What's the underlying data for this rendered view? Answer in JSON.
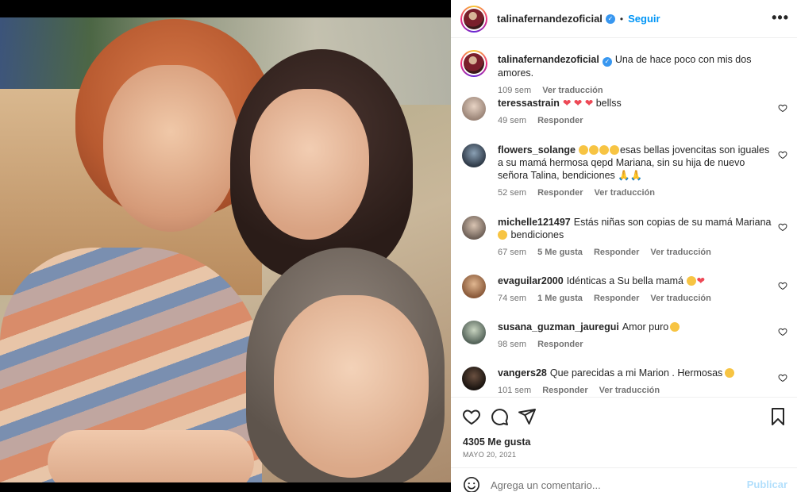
{
  "post": {
    "author": "talinafernandezoficial",
    "follow_label": "Seguir",
    "dot_separator": "•",
    "more_label": "•••",
    "caption": {
      "username": "talinafernandezoficial",
      "text": "Una de hace poco con mis dos amores.",
      "time": "109 sem",
      "translate": "Ver traducción"
    }
  },
  "comments": [
    {
      "username": "teressastrain",
      "text": "bellss",
      "emojis": [
        "red-heart",
        "red-heart",
        "red-heart"
      ],
      "time": "49 sem",
      "likes": "",
      "reply": "Responder",
      "translate": ""
    },
    {
      "username": "flowers_solange",
      "text": "esas bellas jovencitas son iguales a su mamá hermosa qepd Mariana, sin su hija de nuevo señora Talina, bendiciones",
      "emojis": [
        "surprised-face",
        "surprised-face",
        "surprised-face",
        "surprised-face"
      ],
      "trailing_emojis": [
        "praying-hands",
        "praying-hands"
      ],
      "time": "52 sem",
      "likes": "",
      "reply": "Responder",
      "translate": "Ver traducción"
    },
    {
      "username": "michelle121497",
      "text": "Estás niñas son copias de su mamá Mariana",
      "trailing_text": "bendiciones",
      "emojis": [
        "smiling-face"
      ],
      "time": "67 sem",
      "likes": "5 Me gusta",
      "reply": "Responder",
      "translate": "Ver traducción"
    },
    {
      "username": "evaguilar2000",
      "text": "Idénticas a Su bella mamá",
      "trailing_emojis": [
        "screaming-face",
        "red-heart"
      ],
      "time": "74 sem",
      "likes": "1 Me gusta",
      "reply": "Responder",
      "translate": "Ver traducción"
    },
    {
      "username": "susana_guzman_jauregui",
      "text": "Amor puro",
      "trailing_emojis": [
        "heart-eyes-face"
      ],
      "time": "98 sem",
      "likes": "",
      "reply": "Responder",
      "translate": ""
    },
    {
      "username": "vangers28",
      "text": "Que parecidas a mi Marion . Hermosas",
      "trailing_emojis": [
        "heart-eyes-face"
      ],
      "time": "101 sem",
      "likes": "",
      "reply": "Responder",
      "translate": "Ver traducción"
    }
  ],
  "engagement": {
    "likes": "4305 Me gusta",
    "date": "MAYO 20, 2021"
  },
  "composer": {
    "placeholder": "Agrega un comentario...",
    "post_label": "Publicar"
  },
  "colors": {
    "accent": "#0095f6",
    "verified": "#3897f0",
    "heart": "#ed4956",
    "muted": "#737373"
  }
}
